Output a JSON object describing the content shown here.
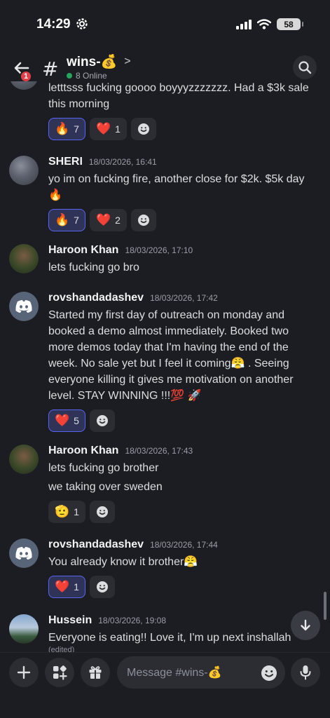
{
  "status_bar": {
    "time": "14:29",
    "battery": "58"
  },
  "header": {
    "back_badge": "1",
    "channel_name": "wins-💰",
    "online": "8 Online"
  },
  "messages": [
    {
      "author": "",
      "timestamp": "",
      "lines": [
        "letttsss fucking goooo boyyyzzzzzzz. Had a $3k sale",
        "this morning"
      ],
      "reactions": [
        {
          "emoji": "🔥",
          "count": "7",
          "me": true
        },
        {
          "emoji": "❤️",
          "count": "1",
          "me": false
        }
      ]
    },
    {
      "author": "SHERI",
      "timestamp": "18/03/2026, 16:41",
      "lines": [
        "yo im on fucking fire, another close for $2k. $5k day",
        "🔥"
      ],
      "reactions": [
        {
          "emoji": "🔥",
          "count": "7",
          "me": true
        },
        {
          "emoji": "❤️",
          "count": "2",
          "me": false
        }
      ]
    },
    {
      "author": "Haroon Khan",
      "timestamp": "18/03/2026, 17:10",
      "lines": [
        "lets fucking go bro"
      ],
      "reactions": []
    },
    {
      "author": "rovshandadashev",
      "timestamp": "18/03/2026, 17:42",
      "lines": [
        "Started my first day of outreach on monday and",
        "booked a demo almost immediately. Booked two",
        "more demos today that I'm having the end of the",
        "week. No sale yet but I feel it coming😤 . Seeing",
        "everyone killing it gives me motivation on another",
        "level. STAY WINNING !!!💯 🚀"
      ],
      "reactions": [
        {
          "emoji": "❤️",
          "count": "5",
          "me": true
        }
      ]
    },
    {
      "author": "Haroon Khan",
      "timestamp": "18/03/2026, 17:43",
      "lines": [
        "lets fucking go brother",
        "we taking over sweden"
      ],
      "reactions": [
        {
          "emoji": "🫡",
          "count": "1",
          "me": false
        }
      ]
    },
    {
      "author": "rovshandadashev",
      "timestamp": "18/03/2026, 17:44",
      "lines": [
        "You already know it brother😤"
      ],
      "reactions": [
        {
          "emoji": "❤️",
          "count": "1",
          "me": true
        }
      ]
    },
    {
      "author": "Hussein",
      "timestamp": "18/03/2026, 19:08",
      "lines": [
        "Everyone is eating!! Love it, I'm up next inshallah"
      ],
      "edited": "(edited)",
      "reactions": []
    }
  ],
  "composer": {
    "placeholder": "Message #wins-💰"
  },
  "icons": {
    "back": "arrow-left-icon",
    "channel": "hash-icon",
    "search": "search-icon",
    "add_reaction": "smile-icon",
    "scroll_down": "arrow-down-icon",
    "plus": "plus-icon",
    "apps": "apps-icon",
    "gift": "gift-icon",
    "emoji": "emoji-icon",
    "mic": "mic-icon"
  },
  "colors": {
    "accent": "#5865f2",
    "online": "#23a55a",
    "badge": "#e13f47"
  }
}
